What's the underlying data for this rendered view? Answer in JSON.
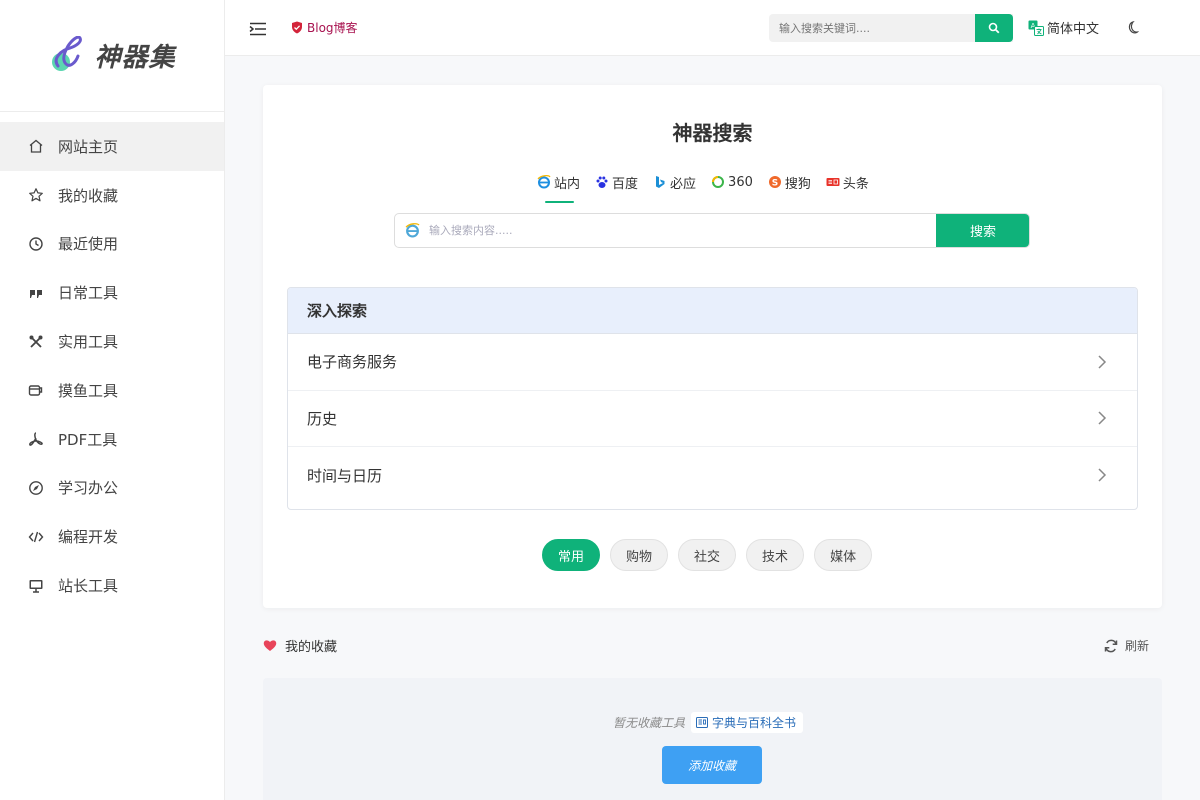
{
  "brand": {
    "name": "神器集"
  },
  "sidebar": {
    "items": [
      {
        "label": "网站主页",
        "icon": "home-icon"
      },
      {
        "label": "我的收藏",
        "icon": "star-icon"
      },
      {
        "label": "最近使用",
        "icon": "clock-icon"
      },
      {
        "label": "日常工具",
        "icon": "quote-icon"
      },
      {
        "label": "实用工具",
        "icon": "tools-icon"
      },
      {
        "label": "摸鱼工具",
        "icon": "coffee-cup-icon"
      },
      {
        "label": "PDF工具",
        "icon": "pdf-icon"
      },
      {
        "label": "学习办公",
        "icon": "compass-icon"
      },
      {
        "label": "编程开发",
        "icon": "code-icon"
      },
      {
        "label": "站长工具",
        "icon": "monitor-icon"
      }
    ]
  },
  "header": {
    "blog_label": "Blog博客",
    "search_placeholder": "输入搜索关键词....",
    "lang_label": "简体中文"
  },
  "main": {
    "title": "神器搜索",
    "engines": [
      "站内",
      "百度",
      "必应",
      "360",
      "搜狗",
      "头条"
    ],
    "search_placeholder": "输入搜索内容.....",
    "search_button": "搜索",
    "explore": {
      "title": "深入探索",
      "rows": [
        "电子商务服务",
        "历史",
        "时间与日历"
      ]
    },
    "tags": [
      "常用",
      "购物",
      "社交",
      "技术",
      "媒体"
    ]
  },
  "favorites": {
    "title": "我的收藏",
    "refresh_label": "刷新",
    "empty_text": "暂无收藏工具",
    "chip_label": "字典与百科全书",
    "add_button": "添加收藏"
  },
  "colors": {
    "accent": "#0fb27a",
    "blog": "#a8124f",
    "add_button": "#3ea0f3",
    "explore_head": "#e8effc"
  }
}
